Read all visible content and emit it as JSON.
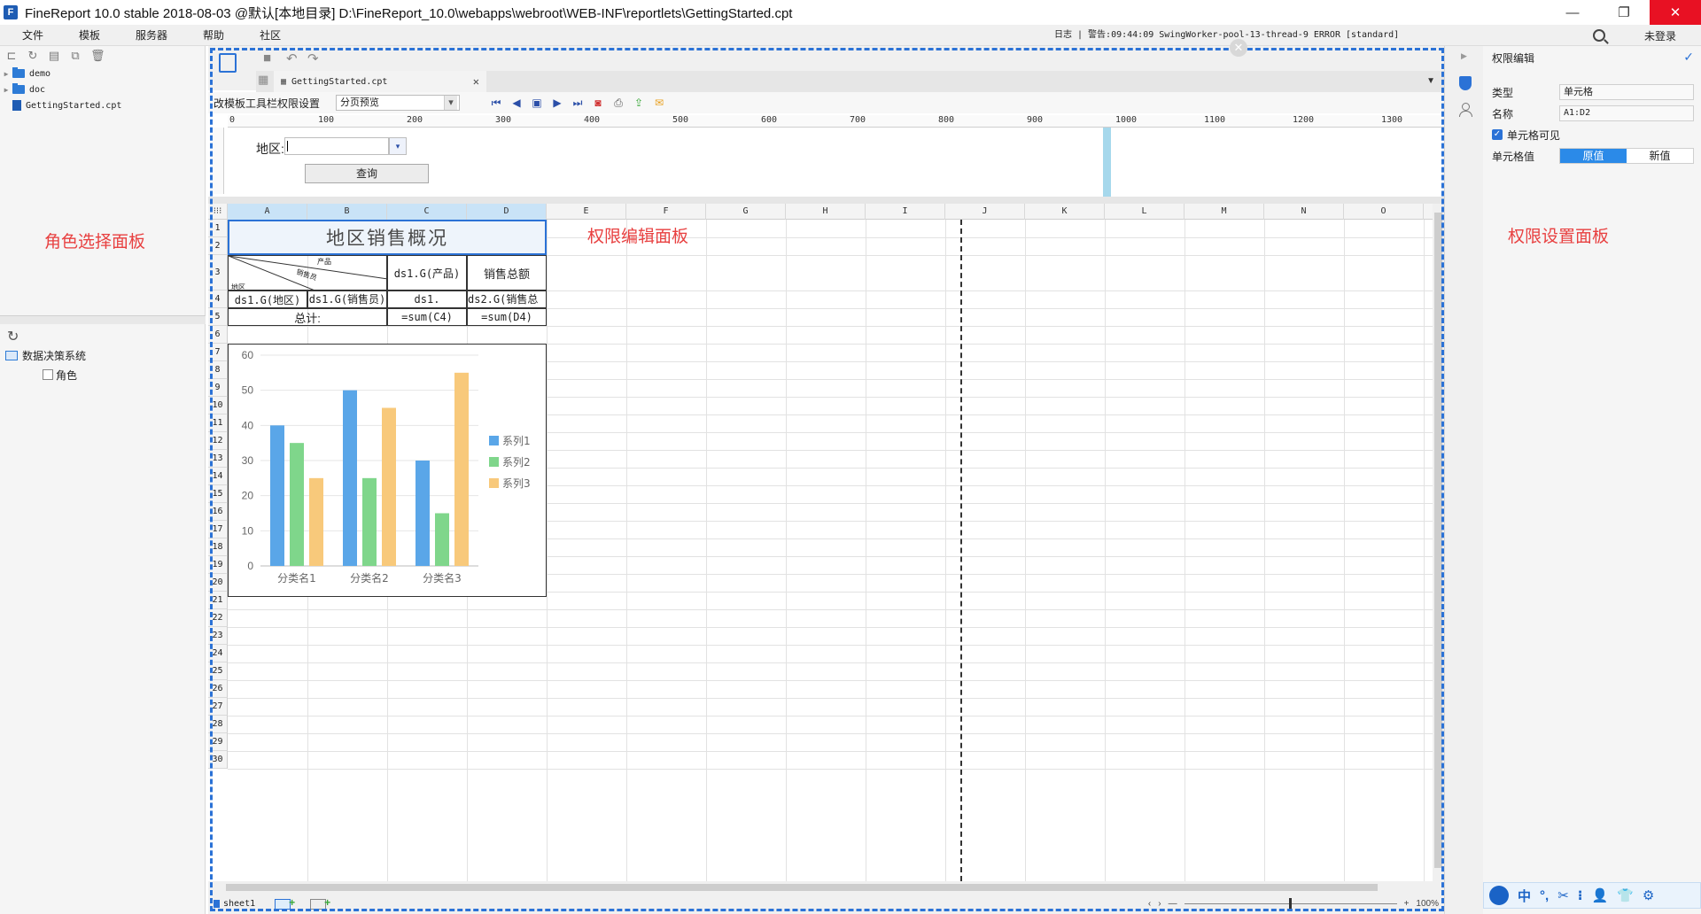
{
  "window": {
    "title": "FineReport 10.0 stable 2018-08-03 @默认[本地目录]    D:\\FineReport_10.0\\webapps\\webroot\\WEB-INF\\reportlets\\GettingStarted.cpt",
    "app_icon": "F",
    "minimize": "—",
    "restore": "❐",
    "close": "✕"
  },
  "menu": {
    "items": [
      "文件",
      "模板",
      "服务器",
      "帮助",
      "社区"
    ],
    "status": "日志 | 警告:09:44:09 SwingWorker-pool-13-thread-9 ERROR [standard]",
    "login": "未登录"
  },
  "left_panel": {
    "tree": [
      {
        "label": "demo",
        "type": "folder"
      },
      {
        "label": "doc",
        "type": "folder"
      },
      {
        "label": "GettingStarted.cpt",
        "type": "file"
      }
    ],
    "annotation": "角色选择面板",
    "datasource": "数据决策系统",
    "role": "角色"
  },
  "editor": {
    "tab": "GettingStarted.cpt",
    "tab_close": "✕",
    "perm_toolbar_label": "改模板工具栏权限设置",
    "preview_mode": "分页预览",
    "ruler_marks": [
      "0",
      "100",
      "200",
      "300",
      "400",
      "500",
      "600",
      "700",
      "800",
      "900",
      "1000",
      "1100",
      "1200",
      "1300"
    ],
    "param_label": "地区:",
    "param_drop": "▾",
    "query_button": "查询",
    "annotation": "权限编辑面板"
  },
  "sheet": {
    "columns": [
      "A",
      "B",
      "C",
      "D",
      "E",
      "F",
      "G",
      "H",
      "I",
      "J",
      "K",
      "L",
      "M",
      "N",
      "O"
    ],
    "corner": "⁝⁝⁝",
    "rows": [
      "1",
      "2",
      "3",
      "4",
      "5",
      "6",
      "7",
      "8",
      "9",
      "10",
      "11",
      "12",
      "13",
      "14",
      "15",
      "16",
      "17",
      "18",
      "19",
      "20",
      "21",
      "22",
      "23",
      "24",
      "25",
      "26",
      "27",
      "28",
      "29",
      "30"
    ],
    "title": "地区销售概况",
    "diag_product": "产品",
    "diag_sales": "销售员",
    "diag_region": "地区",
    "c3": "ds1.G(产品)",
    "d3": "销售总额",
    "a4": "ds1.G(地区)",
    "b4": "ds1.G(销售员)",
    "c4": "ds1.",
    "d4": "ds2.G(销售总额)",
    "a5": "总计:",
    "c5": "=sum(C4)",
    "d5": "=sum(D4)",
    "sheet_name": "sheet1",
    "zoom": "100%",
    "zoom_minus": "—",
    "zoom_plus": "+"
  },
  "chart_data": {
    "type": "bar",
    "categories": [
      "分类名1",
      "分类名2",
      "分类名3"
    ],
    "series": [
      {
        "name": "系列1",
        "values": [
          40,
          50,
          30
        ],
        "color": "#5aa6e8"
      },
      {
        "name": "系列2",
        "values": [
          35,
          25,
          15
        ],
        "color": "#7fd68b"
      },
      {
        "name": "系列3",
        "values": [
          25,
          45,
          55
        ],
        "color": "#f8c97b"
      }
    ],
    "yticks": [
      "0",
      "10",
      "20",
      "30",
      "40",
      "50",
      "60"
    ],
    "ylim": [
      0,
      60
    ],
    "legend": "right",
    "grid": true
  },
  "right_panel": {
    "header": "权限编辑",
    "check": "✓",
    "type_label": "类型",
    "type_value": "单元格",
    "name_label": "名称",
    "name_value": "A1:D2",
    "visible_label": "单元格可见",
    "value_label": "单元格值",
    "seg_original": "原值",
    "seg_new": "新值",
    "annotation": "权限设置面板"
  },
  "ime": {
    "items": [
      "中",
      "°,",
      "✂",
      "⁝",
      "👤",
      "👕",
      "⚙"
    ]
  }
}
